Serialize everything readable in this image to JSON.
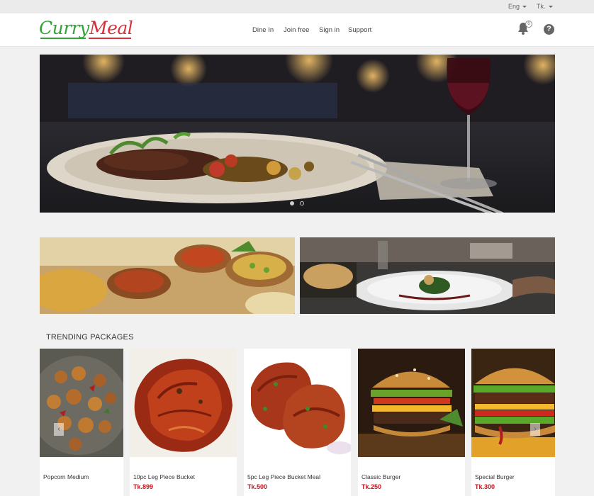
{
  "topbar": {
    "language": "Eng",
    "currency": "Tk."
  },
  "brand": {
    "logo_part1": "Curry",
    "logo_part2": "Meal",
    "green": "#35a33a",
    "red": "#d6313b"
  },
  "nav": {
    "items": [
      "Dine In",
      "Join free",
      "Sign in",
      "Support"
    ]
  },
  "notifications": {
    "icon": "bell-icon",
    "count": "0"
  },
  "help": {
    "icon": "question-circle-icon",
    "glyph": "?"
  },
  "hero": {
    "slides_total": 2,
    "active_slide": 1
  },
  "trending": {
    "title": "TRENDING PACKAGES",
    "price_color": "#c0131b",
    "items": [
      {
        "name": "Popcorn Medium",
        "price": ""
      },
      {
        "name": "10pc Leg Piece Bucket",
        "price": "Tk.899"
      },
      {
        "name": "5pc Leg Piece Bucket Meal",
        "price": "Tk.500"
      },
      {
        "name": "Classic Burger",
        "price": "Tk.250"
      },
      {
        "name": "Special Burger",
        "price": "Tk.300"
      }
    ],
    "prev_icon": "chevron-left-icon",
    "next_icon": "chevron-right-icon",
    "prev_glyph": "‹",
    "next_glyph": "›"
  }
}
